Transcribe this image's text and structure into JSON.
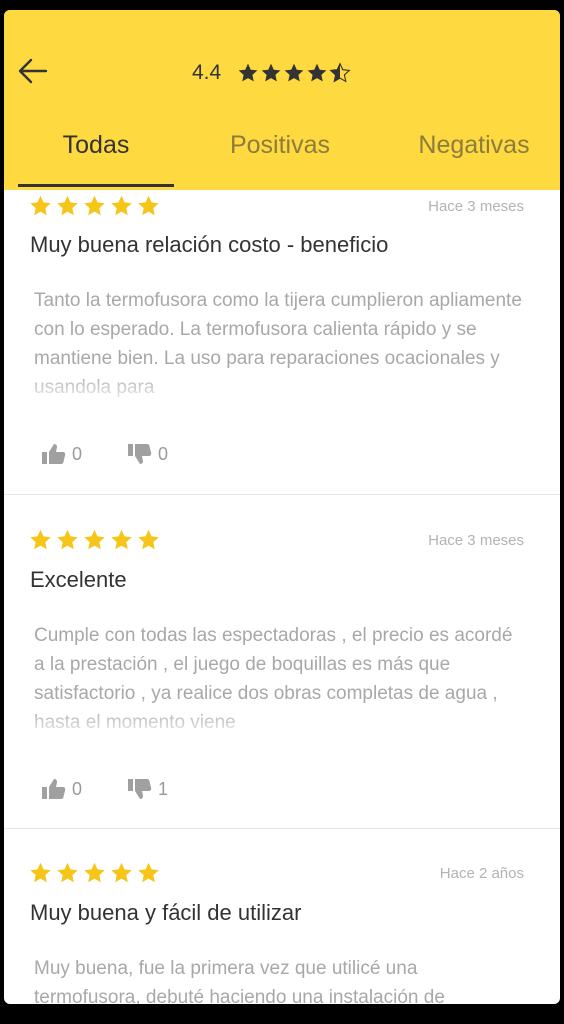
{
  "header": {
    "rating_value": "4.4",
    "rating_stars": 4.5,
    "back_icon": "arrow-left-icon"
  },
  "tabs": [
    {
      "label": "Todas",
      "active": true
    },
    {
      "label": "Positivas",
      "active": false
    },
    {
      "label": "Negativas",
      "active": false
    }
  ],
  "reviews": [
    {
      "stars": 5,
      "date": "Hace 3 meses",
      "title": "Muy buena relación costo - beneficio",
      "body": "Tanto la termofusora como la tijera cumplieron apliamente con lo esperado. La termofusora calienta rápido y se mantiene bien. La uso para reparaciones ocacionales y usandola para",
      "likes": "0",
      "dislikes": "0"
    },
    {
      "stars": 5,
      "date": "Hace 3 meses",
      "title": "Excelente",
      "body": "Cumple con todas las espectadoras , el precio es acordé a la prestación , el juego de boquillas es más que satisfactorio , ya realice dos obras completas de agua , hasta el momento viene",
      "likes": "0",
      "dislikes": "1"
    },
    {
      "stars": 5,
      "date": "Hace 2 años",
      "title": "Muy buena y fácil de utilizar",
      "body": "Muy buena, fue la primera vez que utilicé una termofusora, debuté haciendo una instalación de",
      "likes": "",
      "dislikes": ""
    }
  ],
  "colors": {
    "header_bg": "#fed93f",
    "star": "#f5c518",
    "text_dark": "#333333",
    "text_muted": "#a8a8a8"
  }
}
